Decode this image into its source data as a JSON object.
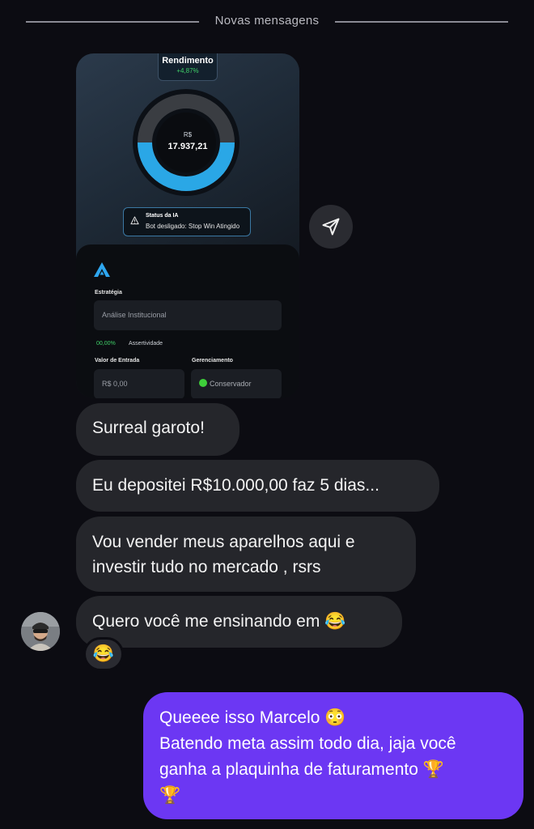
{
  "divider": {
    "label": "Novas mensagens"
  },
  "shared_image": {
    "rendimento_title": "Rendimento",
    "rendimento_pct": "+4,87%",
    "currency_label": "R$",
    "balance": "17.937,21",
    "status_title": "Status da IA",
    "status_text": "Bot desligado: Stop Win Atingido",
    "estrategia_label": "Estratégia",
    "estrategia_value": "Análise Institucional",
    "assert_pct": "00,00%",
    "assert_label": "Assertividade",
    "entrada_label": "Valor de Entrada",
    "entrada_value": "R$ 0,00",
    "gerenciamento_label": "Gerenciamento",
    "gerenciamento_value": "Conservador",
    "donut_fill_fraction": 0.5,
    "accent_color": "#2aa7e6",
    "positive_color": "#3fcf68"
  },
  "messages": [
    {
      "side": "received",
      "text": "Surreal garoto!"
    },
    {
      "side": "received",
      "text": "Eu depositei R$10.000,00 faz 5 dias..."
    },
    {
      "side": "received",
      "line1": "Vou vender meus aparelhos aqui e",
      "line2": "investir tudo no mercado , rsrs"
    },
    {
      "side": "received",
      "text": "Quero você me ensinando em 😂"
    }
  ],
  "reaction": "😂",
  "sent_message": {
    "line1": "Queeee isso Marcelo 😳",
    "line2": "Batendo meta assim todo dia, jaja você",
    "line3": "ganha a plaquinha de faturamento 🏆",
    "line4": "🏆"
  },
  "icons": {
    "share": "send-icon",
    "warning": "warning-icon",
    "logo": "app-logo-icon"
  },
  "colors": {
    "background": "#0c0c12",
    "received_bubble": "#25262b",
    "sent_bubble": "#6c37f3"
  }
}
